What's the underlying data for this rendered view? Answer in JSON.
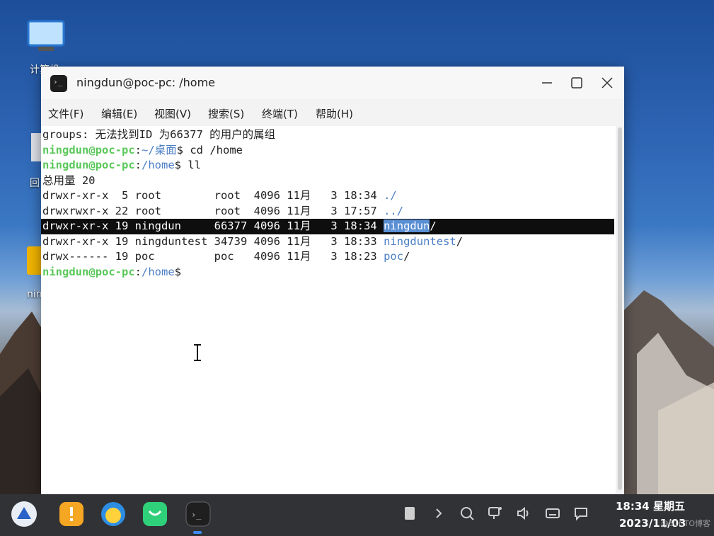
{
  "desktop": {
    "icons": [
      {
        "name": "computer",
        "label": "计算机"
      },
      {
        "name": "trash",
        "label": "回"
      },
      {
        "name": "folder",
        "label": "nin"
      }
    ]
  },
  "window": {
    "title": "ningdun@poc-pc: /home",
    "menu": [
      "文件(F)",
      "编辑(E)",
      "视图(V)",
      "搜索(S)",
      "终端(T)",
      "帮助(H)"
    ]
  },
  "terminal": {
    "line1": "groups: 无法找到ID 为66377 的用户的属组",
    "prompt_user": "ningdun@poc-pc",
    "prompt_sep": ":",
    "path1": "~/桌面",
    "cmd1": "$ cd /home",
    "path2": "/home",
    "cmd2": "$ ll",
    "total": "总用量 20",
    "rows": [
      {
        "meta": "drwxr-xr-x  5 root        root  4096 11月   3 18:34 ",
        "name": "./",
        "slash": ""
      },
      {
        "meta": "drwxrwxr-x 22 root        root  4096 11月   3 17:57 ",
        "name": "../",
        "slash": ""
      },
      {
        "meta": "drwxr-xr-x 19 ningdun     66377 4096 11月   3 18:34 ",
        "name": "ningdun",
        "slash": "/"
      },
      {
        "meta": "drwxr-xr-x 19 ningduntest 34739 4096 11月   3 18:33 ",
        "name": "ningduntest",
        "slash": "/"
      },
      {
        "meta": "drwx------ 19 poc         poc   4096 11月   3 18:23 ",
        "name": "poc",
        "slash": "/"
      }
    ],
    "final_cmd": "$"
  },
  "taskbar": {
    "apps": [
      "launcher-icon",
      "notes-icon",
      "browser-icon",
      "app-store-icon",
      "terminal-icon"
    ],
    "tray": [
      "clipboard-icon",
      "chevron-right-icon",
      "search-icon",
      "network-icon",
      "volume-icon",
      "keyboard-icon",
      "notification-icon"
    ],
    "time": "18:34 星期五",
    "date": "2023/11/03",
    "watermark": "@51CTO博客"
  },
  "colors": {
    "prompt": "#5ac85a",
    "directory": "#4c7fc6",
    "selection_bg": "#0e0e0e",
    "name_highlight": "#5a8fd3"
  }
}
